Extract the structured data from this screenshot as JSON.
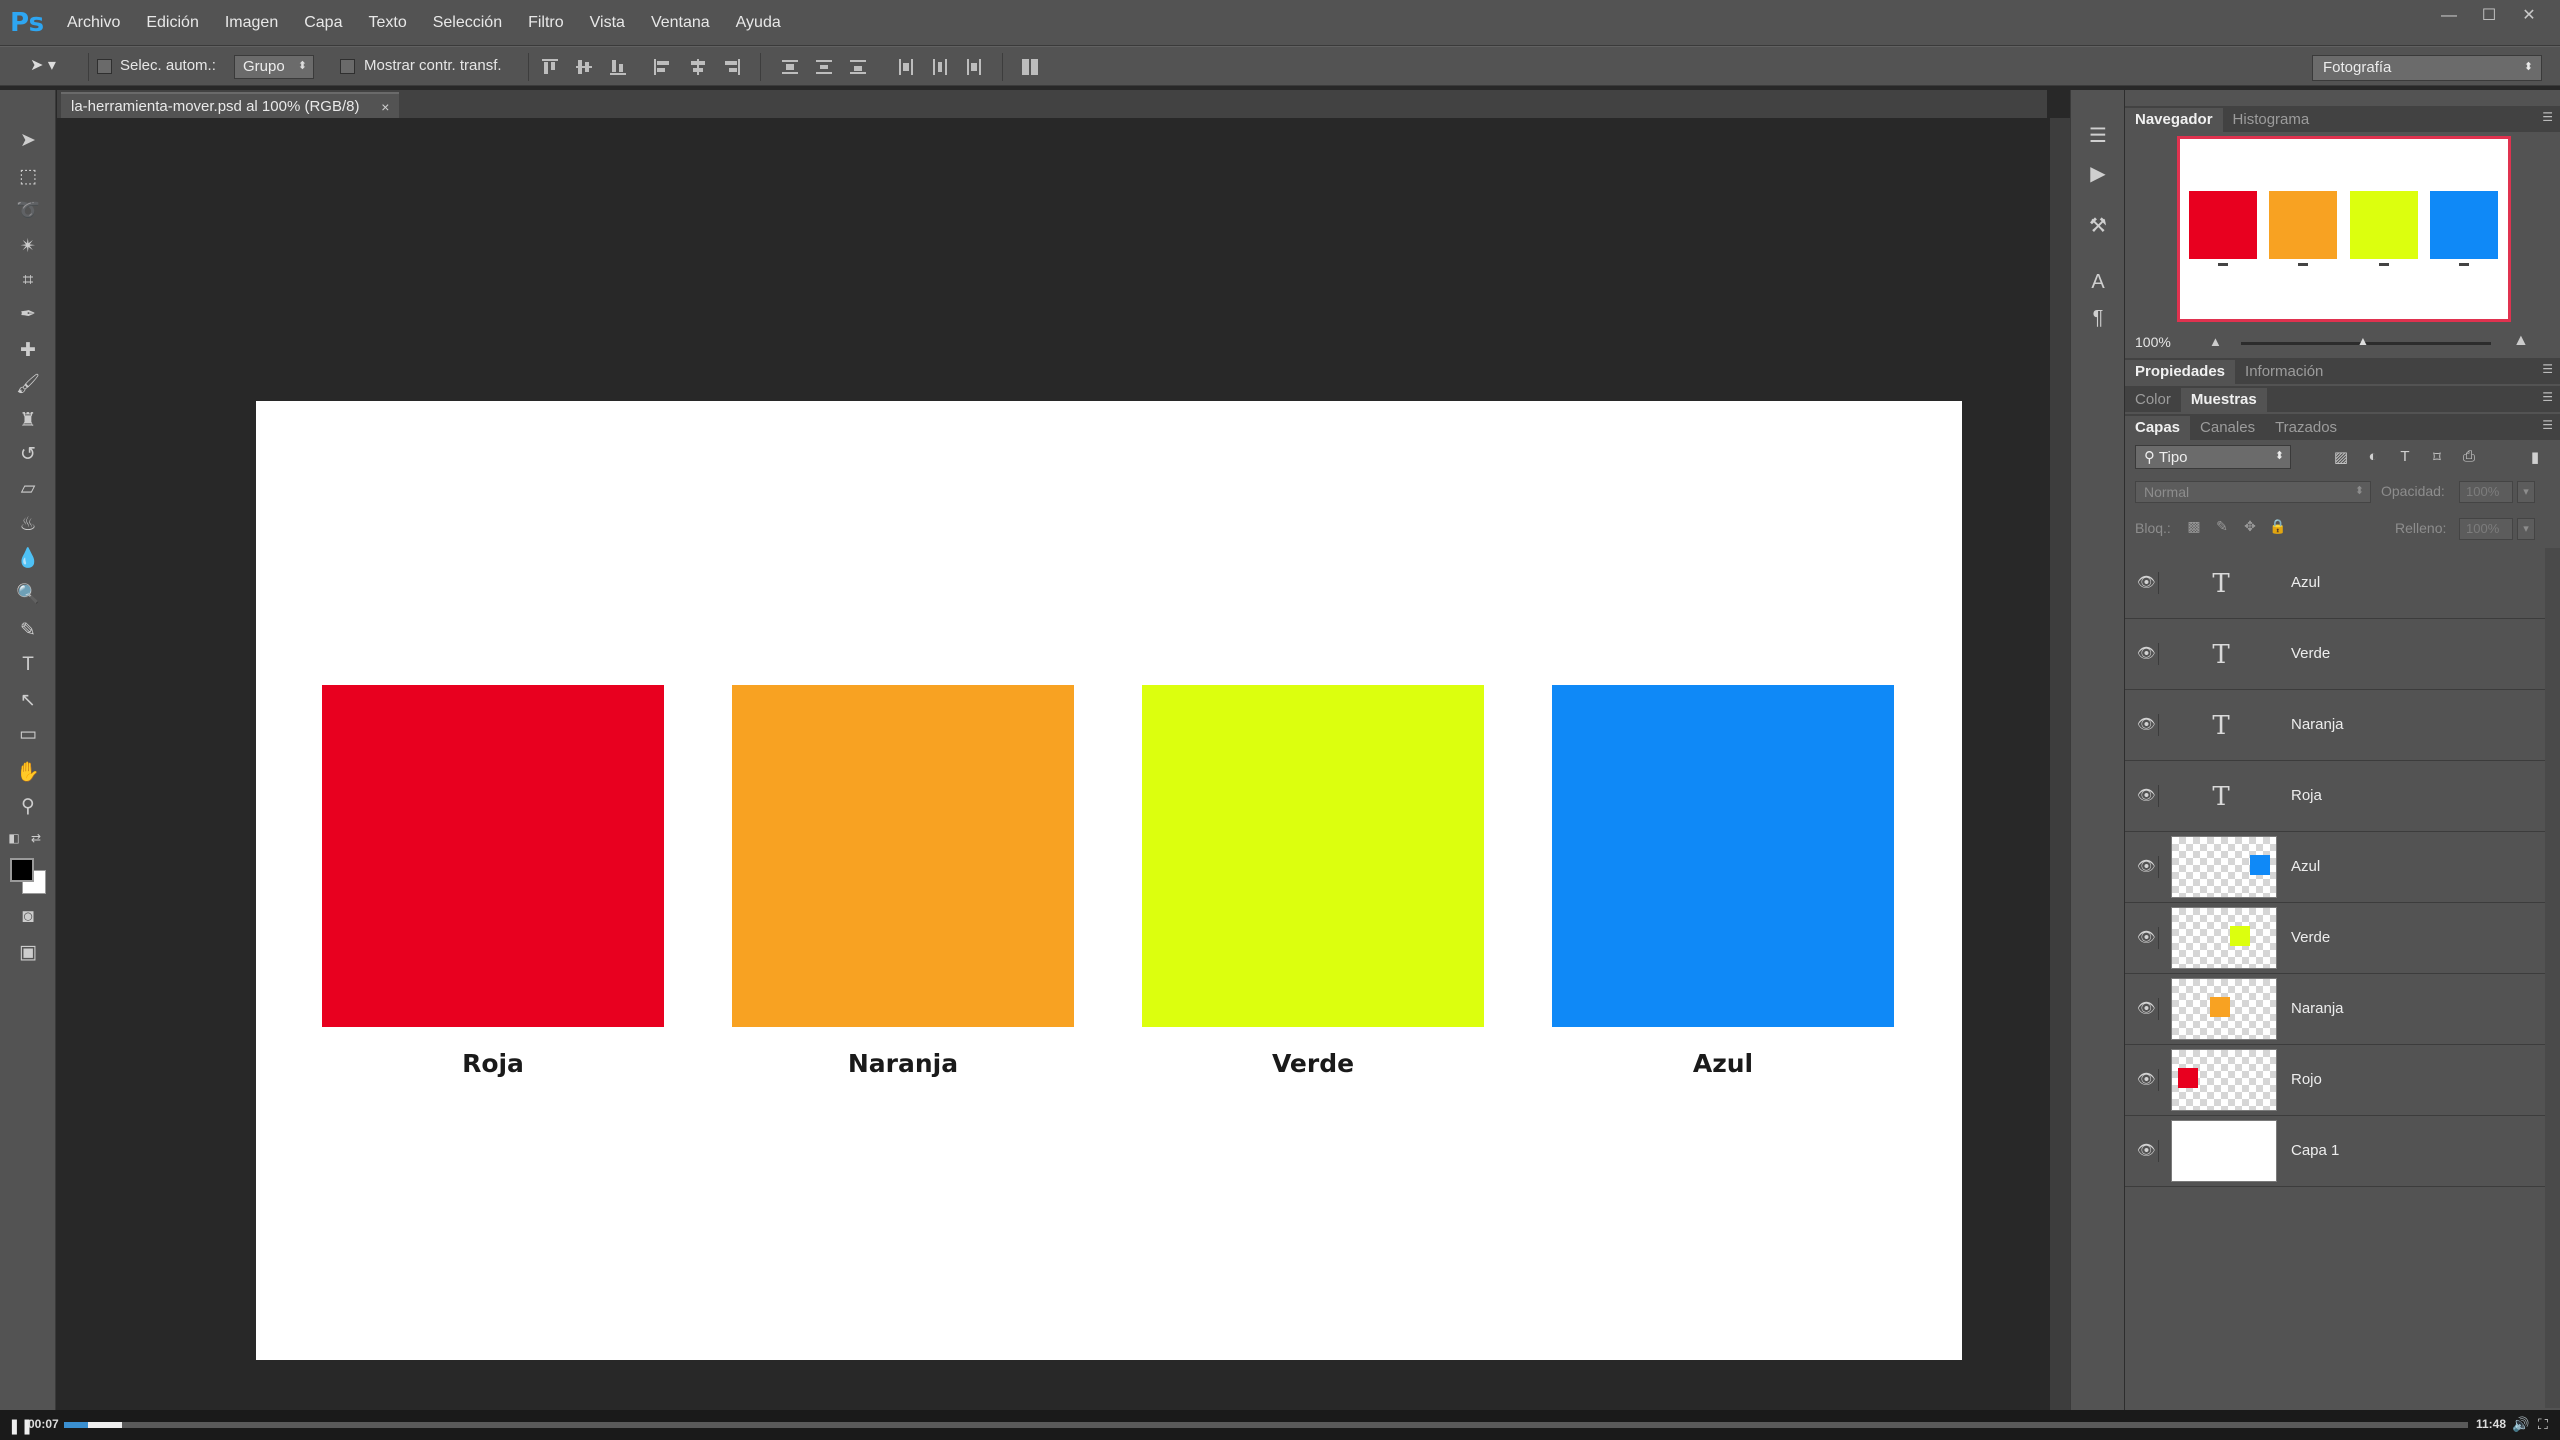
{
  "app": {
    "logo": "Ps"
  },
  "menu": [
    "Archivo",
    "Edición",
    "Imagen",
    "Capa",
    "Texto",
    "Selección",
    "Filtro",
    "Vista",
    "Ventana",
    "Ayuda"
  ],
  "options": {
    "auto_select_label": "Selec. autom.:",
    "auto_select_value": "Grupo",
    "transform_label": "Mostrar contr. transf.",
    "workspace": "Fotografía"
  },
  "document": {
    "tab_title": "la-herramienta-mover.psd al 100% (RGB/8)",
    "swatches": [
      {
        "label": "Roja",
        "color": "#e8001f"
      },
      {
        "label": "Naranja",
        "color": "#f8a222"
      },
      {
        "label": "Verde",
        "color": "#dcff0e"
      },
      {
        "label": "Azul",
        "color": "#0f89f7"
      }
    ]
  },
  "navigator": {
    "tabs": [
      "Navegador",
      "Histograma"
    ],
    "zoom": "100%"
  },
  "panel_groups": {
    "properties_tabs": [
      "Propiedades",
      "Información"
    ],
    "color_tabs": [
      "Color",
      "Muestras"
    ],
    "layers_tabs": [
      "Capas",
      "Canales",
      "Trazados"
    ]
  },
  "layers_panel": {
    "filter": "Tipo",
    "blend_mode": "Normal",
    "opacity_label": "Opacidad:",
    "opacity_value": "100%",
    "lock_label": "Bloq.:",
    "fill_label": "Relleno:",
    "fill_value": "100%",
    "layers": [
      {
        "name": "Azul",
        "kind": "text"
      },
      {
        "name": "Verde",
        "kind": "text"
      },
      {
        "name": "Naranja",
        "kind": "text"
      },
      {
        "name": "Roja",
        "kind": "text"
      },
      {
        "name": "Azul",
        "kind": "shape",
        "color": "#0f89f7"
      },
      {
        "name": "Verde",
        "kind": "shape",
        "color": "#dcff0e"
      },
      {
        "name": "Naranja",
        "kind": "shape",
        "color": "#f8a222"
      },
      {
        "name": "Rojo",
        "kind": "shape",
        "color": "#e8001f"
      },
      {
        "name": "Capa 1",
        "kind": "background"
      }
    ]
  },
  "video": {
    "elapsed": "00:07",
    "total": "11:48",
    "progress_fraction": 0.01,
    "buffer_fraction": 0.012
  },
  "colors": {
    "foreground": "#000000",
    "background": "#ffffff",
    "accent": "#2ea6f2"
  }
}
